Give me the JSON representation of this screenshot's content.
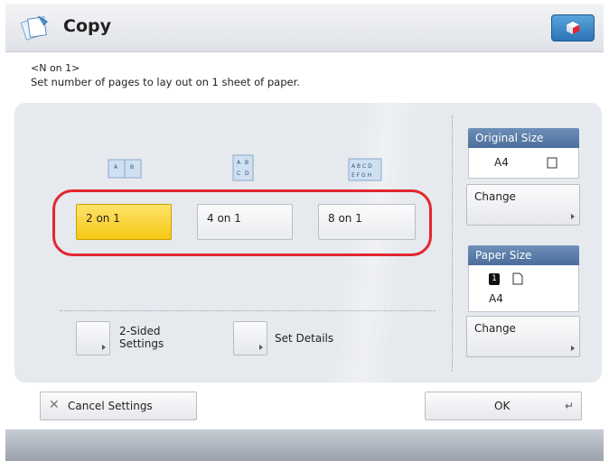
{
  "window": {
    "title": "Copy",
    "app_icon": "copy-pages-icon",
    "corner_icon": "cube-icon"
  },
  "instructions": {
    "heading": "<N on 1>",
    "text": "Set number of pages to lay out on 1 sheet of paper."
  },
  "layouts": [
    {
      "label": "2 on 1",
      "selected": true,
      "preview_text": "A  B"
    },
    {
      "label": "4 on 1",
      "selected": false,
      "preview_text": [
        "A B",
        "C D"
      ]
    },
    {
      "label": "8 on 1",
      "selected": false,
      "preview_text": [
        "ABCD",
        "EFGH"
      ]
    }
  ],
  "options": {
    "two_sided": {
      "line1": "2-Sided",
      "line2": "Settings"
    },
    "set_details": "Set Details"
  },
  "original_size": {
    "title": "Original Size",
    "value": "A4",
    "change_label": "Change",
    "orientation_icon": "portrait-page-icon"
  },
  "paper_size": {
    "title": "Paper Size",
    "value": "A4",
    "drawer_number": "1",
    "change_label": "Change",
    "orientation_icon": "portrait-page-icon"
  },
  "footer": {
    "cancel_label": "Cancel Settings",
    "cancel_icon": "close-icon",
    "ok_label": "OK",
    "ok_icon": "enter-return-icon"
  },
  "colors": {
    "selected": "#f5c814",
    "highlight_ring": "#e2262d",
    "card_header": "#4a6d9a",
    "accent_button": "#2b74b6"
  }
}
